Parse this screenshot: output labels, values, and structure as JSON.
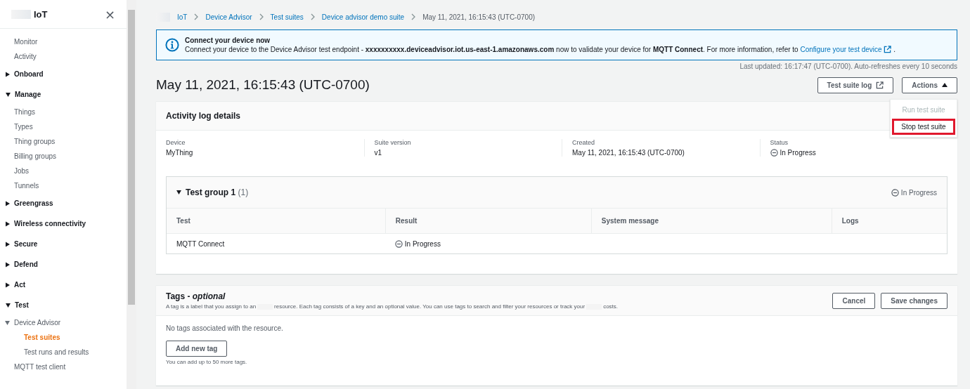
{
  "sidebar": {
    "title": "IoT",
    "close": "×",
    "items": [
      {
        "kind": "link",
        "label": "Monitor",
        "selected": false
      },
      {
        "kind": "link",
        "label": "Activity",
        "selected": false
      },
      {
        "kind": "section",
        "label": "Onboard",
        "expanded": false
      },
      {
        "kind": "section",
        "label": "Manage",
        "expanded": true,
        "children": [
          {
            "kind": "link",
            "label": "Things",
            "selected": false
          },
          {
            "kind": "link",
            "label": "Types",
            "selected": false
          },
          {
            "kind": "link",
            "label": "Thing groups",
            "selected": false
          },
          {
            "kind": "link",
            "label": "Billing groups",
            "selected": false
          },
          {
            "kind": "link",
            "label": "Jobs",
            "selected": false
          },
          {
            "kind": "link",
            "label": "Tunnels",
            "selected": false
          }
        ]
      },
      {
        "kind": "section",
        "label": "Greengrass",
        "expanded": false
      },
      {
        "kind": "section",
        "label": "Wireless connectivity",
        "expanded": false
      },
      {
        "kind": "section",
        "label": "Secure",
        "expanded": false
      },
      {
        "kind": "section",
        "label": "Defend",
        "expanded": false
      },
      {
        "kind": "section",
        "label": "Act",
        "expanded": false
      },
      {
        "kind": "section",
        "label": "Test",
        "expanded": true,
        "children": [
          {
            "kind": "group",
            "label": "Device Advisor",
            "expanded": true,
            "children": [
              {
                "kind": "link",
                "label": "Test suites",
                "selected": true
              },
              {
                "kind": "link",
                "label": "Test runs and results",
                "selected": false
              }
            ]
          },
          {
            "kind": "link",
            "label": "MQTT test client",
            "selected": false
          }
        ]
      }
    ]
  },
  "breadcrumbs": [
    {
      "label": "IoT"
    },
    {
      "label": "Device Advisor"
    },
    {
      "label": "Test suites"
    },
    {
      "label": "Device advisor demo suite"
    },
    {
      "label": "May 11, 2021, 16:15:43 (UTC-0700)"
    }
  ],
  "alert": {
    "title": "Connect your device now",
    "text": "Connect your device to the Device Advisor test endpoint - **xxxxxxxxxx.deviceadvisor.iot.us-east-1.amazonaws.com** now to validate your device for **MQTT Connect**. For more information, refer to",
    "link": "Configure your test device",
    "text_after": "."
  },
  "last_updated": "Last updated: 16:17:47 (UTC-0700). Auto-refreshes every 10 seconds",
  "page_title": "May 11, 2021, 16:15:43 (UTC-0700)",
  "header_buttons": {
    "log": "Test suite log",
    "actions": "Actions",
    "menu_open": true
  },
  "actions_menu": [
    {
      "label": "Run test suite",
      "disabled": true,
      "highlighted": false
    },
    {
      "label": "Stop test suite",
      "disabled": false,
      "highlighted": true
    }
  ],
  "details": {
    "title": "Activity log details",
    "fields": [
      {
        "label": "Device",
        "value": "MyThing",
        "kind": "text"
      },
      {
        "label": "Suite version",
        "value": "v1",
        "kind": "text"
      },
      {
        "label": "Created",
        "value": "May 11, 2021, 16:15:43 (UTC-0700)",
        "kind": "text"
      },
      {
        "label": "Status",
        "value": "In Progress",
        "kind": "status"
      }
    ]
  },
  "test_group": {
    "title": "Test group 1",
    "count": "(1)",
    "expanded": true,
    "status": "In Progress",
    "columns": [
      "Test",
      "Result",
      "System message",
      "Logs"
    ],
    "rows": [
      {
        "test": "MQTT Connect",
        "result": "In Progress"
      }
    ]
  },
  "tags": {
    "title": "Tags - ",
    "title_em": "optional",
    "description_parts": [
      "A tag is a label that you assign to an",
      "resource. Each tag consists of a key and an optional value. You can use tags to search and filter your resources or track your",
      "costs."
    ],
    "cancel": "Cancel",
    "save": "Save changes",
    "empty": "No tags associated with the resource.",
    "add": "Add new tag",
    "hint": "You can add up to 50 more tags."
  }
}
